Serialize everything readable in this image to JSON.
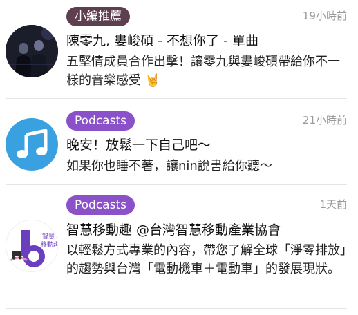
{
  "feed": [
    {
      "badge": "小編推薦",
      "time": "19小時前",
      "title": "陳零九, 婁峻碩 - 不想你了 - 單曲",
      "description": "五堅情成員合作出擊！讓零九與婁峻碩帶給你不一樣的音樂感受 🤘"
    },
    {
      "badge": "Podcasts",
      "time": "21小時前",
      "title": "晚安！放鬆一下自己吧～",
      "description": "如果你也睡不著，讓nin說書給你聽～"
    },
    {
      "badge": "Podcasts",
      "time": "1天前",
      "title": "智慧移動趣 @台灣智慧移動產業協會",
      "description": "以輕鬆方式專業的內容，帶您了解全球「淨零排放」的趨勢與台灣「電動機車＋電動車」的發展現狀。",
      "thumbnail_text": "智慧移動趣"
    }
  ],
  "colors": {
    "editor_badge": "#5e3f4f",
    "podcast_badge": "#8b51c9",
    "podcast_icon_bg": "#3aa1e0"
  },
  "icons": [
    "album-cover",
    "music-note-icon",
    "podcast-cover"
  ]
}
